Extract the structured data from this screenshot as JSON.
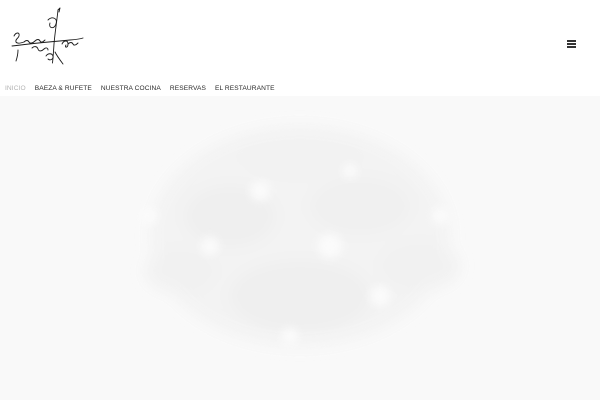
{
  "logo": {
    "name": "Baeza & Rufete signature logo"
  },
  "menu": {
    "icon": "hamburger-menu-icon"
  },
  "nav": {
    "items": [
      {
        "label": "INICIO",
        "active": true
      },
      {
        "label": "BAEZA & RUFETE",
        "active": false
      },
      {
        "label": "NUESTRA COCINA",
        "active": false
      },
      {
        "label": "RESERVAS",
        "active": false
      },
      {
        "label": "EL RESTAURANTE",
        "active": false
      }
    ]
  },
  "hero": {
    "background": "#f9f9f9"
  }
}
